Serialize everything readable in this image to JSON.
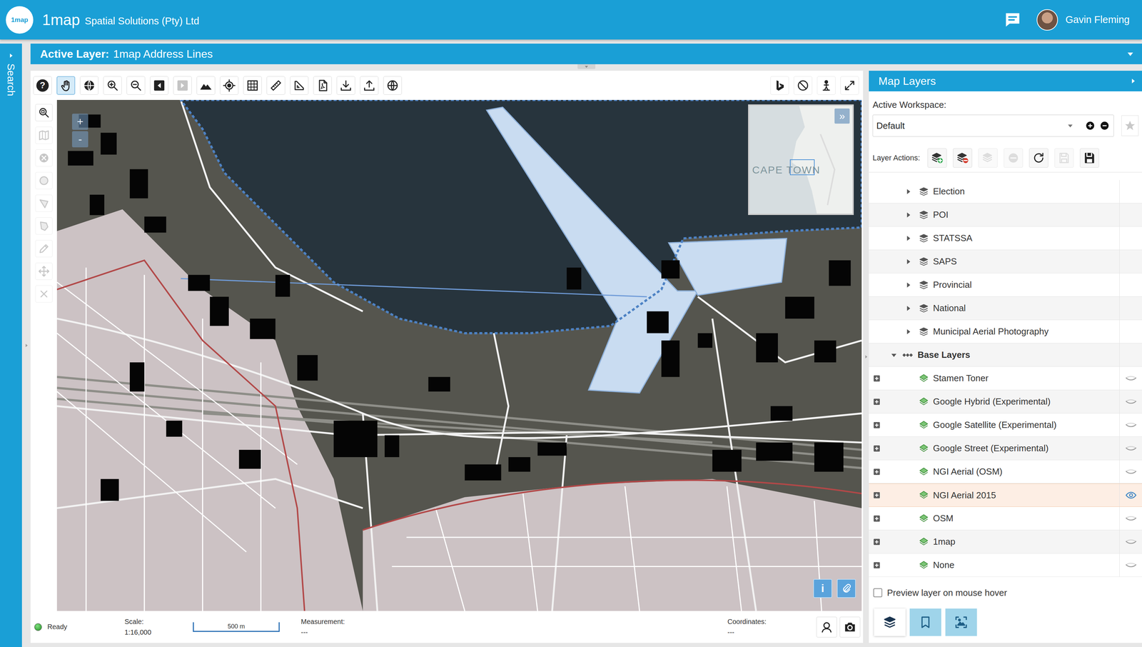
{
  "header": {
    "logo": "1map",
    "brand": "1map",
    "company": "Spatial Solutions (Pty) Ltd",
    "user": "Gavin Fleming"
  },
  "search_rail": {
    "label": "Search"
  },
  "active_layer": {
    "label": "Active Layer:",
    "value": "1map Address Lines"
  },
  "toolbar": {
    "help": "?",
    "tools": [
      {
        "selected": true,
        "disabled": false
      },
      {
        "selected": false,
        "disabled": false
      },
      {
        "selected": false,
        "disabled": false
      },
      {
        "selected": false,
        "disabled": false
      },
      {
        "selected": false,
        "disabled": false
      },
      {
        "selected": false,
        "disabled": true
      },
      {
        "selected": false,
        "disabled": false
      },
      {
        "selected": false,
        "disabled": false
      },
      {
        "selected": false,
        "disabled": false
      },
      {
        "selected": false,
        "disabled": false
      },
      {
        "selected": false,
        "disabled": false
      },
      {
        "selected": false,
        "disabled": false
      },
      {
        "selected": false,
        "disabled": false
      },
      {
        "selected": false,
        "disabled": false
      },
      {
        "selected": false,
        "disabled": false
      }
    ],
    "right_tools": [
      {
        "selected": false,
        "disabled": false
      },
      {
        "selected": false,
        "disabled": false
      },
      {
        "selected": false,
        "disabled": false
      },
      {
        "selected": false,
        "disabled": false
      }
    ]
  },
  "side_tools": [
    {
      "selected": false,
      "disabled": false
    },
    {
      "selected": false,
      "disabled": true
    },
    {
      "selected": false,
      "disabled": true
    },
    {
      "selected": false,
      "disabled": true
    },
    {
      "selected": false,
      "disabled": true
    },
    {
      "selected": false,
      "disabled": true
    },
    {
      "selected": false,
      "disabled": true
    },
    {
      "selected": false,
      "disabled": true
    },
    {
      "selected": false,
      "disabled": true
    }
  ],
  "map": {
    "zoom_in": "+",
    "zoom_out": "-",
    "info": "i",
    "overview": {
      "label": "CAPE TOWN",
      "toggle": "»"
    }
  },
  "status_bar": {
    "state": "Ready",
    "ok": true,
    "scale_label": "Scale:",
    "scale_value": "1:16,000",
    "scale_bar": "500 m",
    "measurement_label": "Measurement:",
    "measurement_value": "---",
    "coordinates_label": "Coordinates:",
    "coordinates_value": "---"
  },
  "layers_panel": {
    "title": "Map Layers",
    "workspace_label": "Active Workspace:",
    "workspace": "Default",
    "actions_label": "Layer Actions:",
    "actions": [
      {
        "disabled": false
      },
      {
        "disabled": false
      },
      {
        "disabled": true
      },
      {
        "disabled": true
      },
      {
        "disabled": false
      },
      {
        "disabled": true
      },
      {
        "disabled": false
      }
    ],
    "groups": [
      {
        "name": "Election",
        "expanded": false
      },
      {
        "name": "POI",
        "expanded": false
      },
      {
        "name": "STATSSA",
        "expanded": false
      },
      {
        "name": "SAPS",
        "expanded": false
      },
      {
        "name": "Provincial",
        "expanded": false
      },
      {
        "name": "National",
        "expanded": false
      },
      {
        "name": "Municipal Aerial Photography",
        "expanded": false
      }
    ],
    "base_group": {
      "name": "Base Layers",
      "expanded": true,
      "layers": [
        {
          "name": "Stamen Toner",
          "visible": false,
          "selected": false
        },
        {
          "name": "Google Hybrid (Experimental)",
          "visible": false,
          "selected": false
        },
        {
          "name": "Google Satellite (Experimental)",
          "visible": false,
          "selected": false
        },
        {
          "name": "Google Street (Experimental)",
          "visible": false,
          "selected": false
        },
        {
          "name": "NGI Aerial (OSM)",
          "visible": false,
          "selected": false
        },
        {
          "name": "NGI Aerial 2015",
          "visible": true,
          "selected": true
        },
        {
          "name": "OSM",
          "visible": false,
          "selected": false
        },
        {
          "name": "1map",
          "visible": false,
          "selected": false
        },
        {
          "name": "None",
          "visible": false,
          "selected": false
        }
      ]
    },
    "preview": {
      "label": "Preview layer on mouse hover",
      "checked": false
    },
    "tabs": [
      {
        "selected": true
      },
      {
        "selected": false
      },
      {
        "selected": false
      }
    ]
  }
}
